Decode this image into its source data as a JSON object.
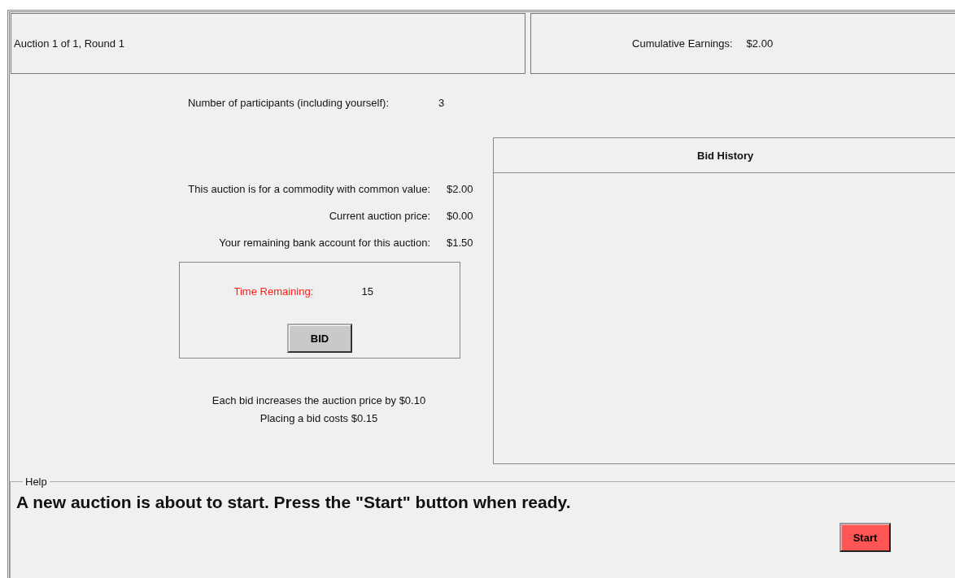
{
  "header": {
    "auction_round": "Auction 1 of 1, Round 1",
    "earnings_label": "Cumulative Earnings:",
    "earnings_value": "$2.00"
  },
  "participants": {
    "label": "Number of participants (including yourself):",
    "value": "3"
  },
  "info_rows": [
    {
      "label": "This auction is for a commodity with common value:",
      "value": "$2.00"
    },
    {
      "label": "Current auction price:",
      "value": "$0.00"
    },
    {
      "label": "Your remaining bank account for this auction:",
      "value": "$1.50"
    }
  ],
  "timer": {
    "label": "Time Remaining:",
    "value": "15"
  },
  "bid_button": "BID",
  "notes": [
    "Each bid increases the auction price by $0.10",
    "Placing a bid costs $0.15"
  ],
  "bid_history": {
    "title": "Bid History"
  },
  "help": {
    "legend": "Help",
    "message": "A new auction is about to start. Press the \"Start\" button when ready.",
    "start_button": "Start"
  }
}
